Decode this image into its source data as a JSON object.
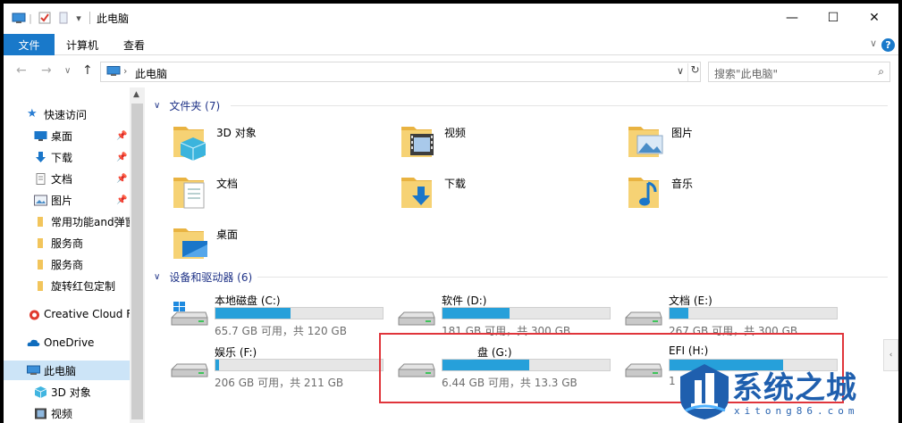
{
  "window": {
    "title": "此电脑",
    "buttons": {
      "minimize": "—",
      "maximize": "☐",
      "close": "✕"
    }
  },
  "ribbon": {
    "file_tab": "文件",
    "tabs": [
      "计算机",
      "查看"
    ],
    "collapse_glyph": "∨",
    "help_glyph": "?"
  },
  "address": {
    "path": "此电脑",
    "separator": "›",
    "search_placeholder": "搜索\"此电脑\""
  },
  "nav": {
    "quick_access": "快速访问",
    "pinned": [
      {
        "label": "桌面",
        "icon": "desktop-icon"
      },
      {
        "label": "下载",
        "icon": "download-icon"
      },
      {
        "label": "文档",
        "icon": "document-icon"
      },
      {
        "label": "图片",
        "icon": "picture-icon"
      }
    ],
    "folders": [
      {
        "label": "常用功能and弹窗"
      },
      {
        "label": "服务商"
      },
      {
        "label": "服务商"
      },
      {
        "label": "旋转红包定制"
      }
    ],
    "creative_cloud": "Creative Cloud F",
    "onedrive": "OneDrive",
    "this_pc": "此电脑",
    "pc_children": [
      {
        "label": "3D 对象",
        "icon": "3d-objects-icon"
      },
      {
        "label": "视频",
        "icon": "video-icon"
      }
    ]
  },
  "content": {
    "folders_header": "文件夹 (7)",
    "folders": [
      {
        "name": "3D 对象",
        "icon": "3d-objects-folder-icon"
      },
      {
        "name": "视频",
        "icon": "video-folder-icon"
      },
      {
        "name": "图片",
        "icon": "pictures-folder-icon"
      },
      {
        "name": "文档",
        "icon": "documents-folder-icon"
      },
      {
        "name": "下载",
        "icon": "downloads-folder-icon"
      },
      {
        "name": "音乐",
        "icon": "music-folder-icon"
      },
      {
        "name": "桌面",
        "icon": "desktop-folder-icon"
      }
    ],
    "drives_header": "设备和驱动器 (6)",
    "drives": [
      {
        "name": "本地磁盘 (C:)",
        "space": "65.7 GB 可用，共 120 GB",
        "used_fraction": 0.45,
        "system": true
      },
      {
        "name": "软件 (D:)",
        "space": "181 GB 可用，共 300 GB",
        "used_fraction": 0.4,
        "system": false
      },
      {
        "name": "文档 (E:)",
        "space": "267 GB 可用，共 300 GB",
        "used_fraction": 0.11,
        "system": false
      },
      {
        "name": "娱乐 (F:)",
        "space": "206 GB 可用，共 211 GB",
        "used_fraction": 0.02,
        "system": false
      },
      {
        "name": "盘 (G:)",
        "space": "6.44 GB 可用，共 13.3 GB",
        "used_fraction": 0.52,
        "system": false
      },
      {
        "name": "EFI (H:)",
        "space": "1",
        "used_fraction": 0.68,
        "system": false
      }
    ]
  },
  "watermark": {
    "title": "系统之城",
    "url": "xitong86.com"
  },
  "colors": {
    "accent": "#1979ca",
    "bar_fill": "#26a0da",
    "selection": "#cce4f7",
    "highlight_box": "#e0353b",
    "group_header": "#1e3287"
  }
}
